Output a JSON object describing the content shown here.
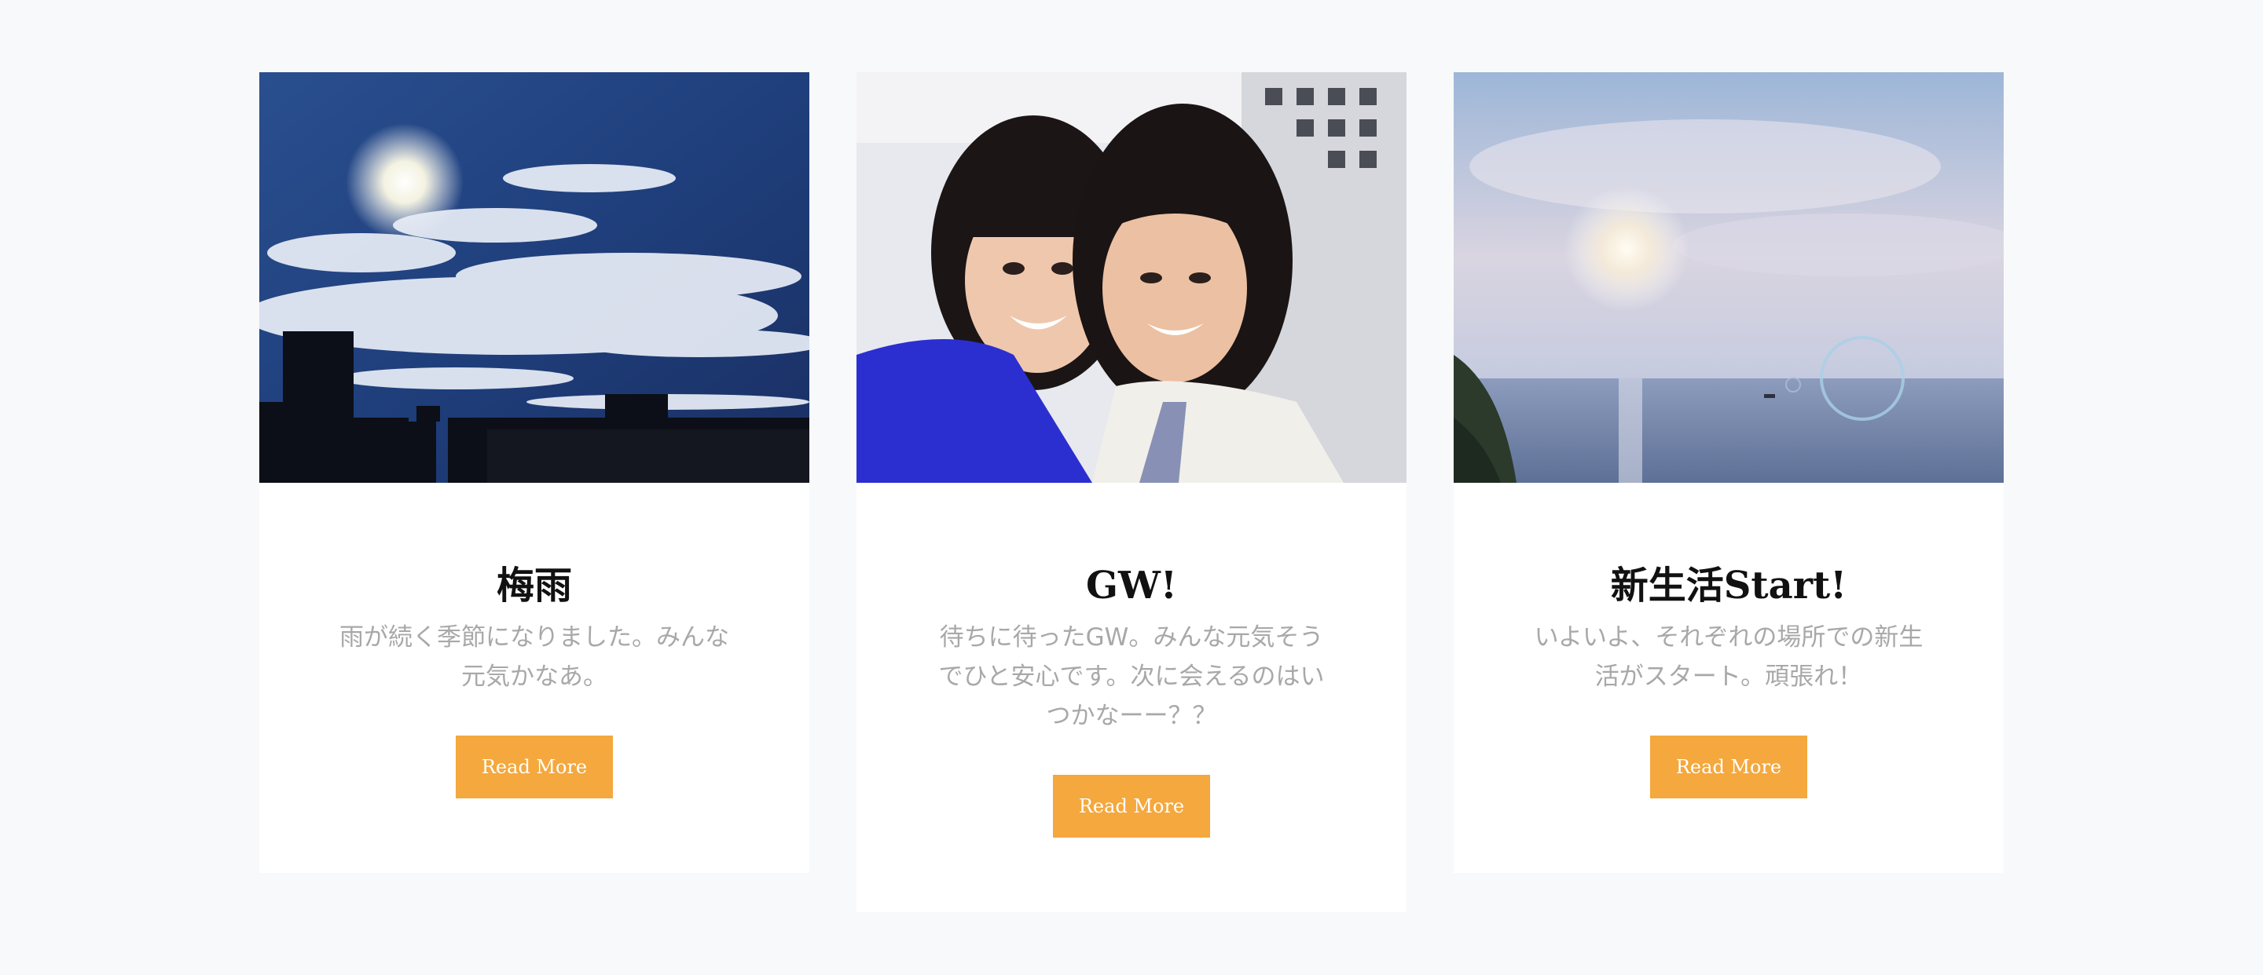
{
  "colors": {
    "page_background": "#f8f9fa",
    "card_background": "#ffffff",
    "button_background": "#f4a83d",
    "button_text": "#ffffff",
    "title_text": "#111111",
    "body_text": "#a8a8a8"
  },
  "cards": [
    {
      "title": "梅雨",
      "text": "雨が続く季節になりました。みんな元気かなあ。",
      "button_label": "Read More",
      "image": "sky-with-sun-and-clouds-over-city-skyline"
    },
    {
      "title": "GW!",
      "text": "待ちに待ったGW。みんな元気そうでひと安心です。次に会えるのはいつかなーー？？",
      "button_label": "Read More",
      "image": "two-smiling-women-selfie"
    },
    {
      "title": "新生活Start!",
      "text": "いよいよ、それぞれの場所での新生活がスタート。頑張れ！",
      "button_label": "Read More",
      "image": "sunset-over-sea-with-bubble"
    }
  ]
}
